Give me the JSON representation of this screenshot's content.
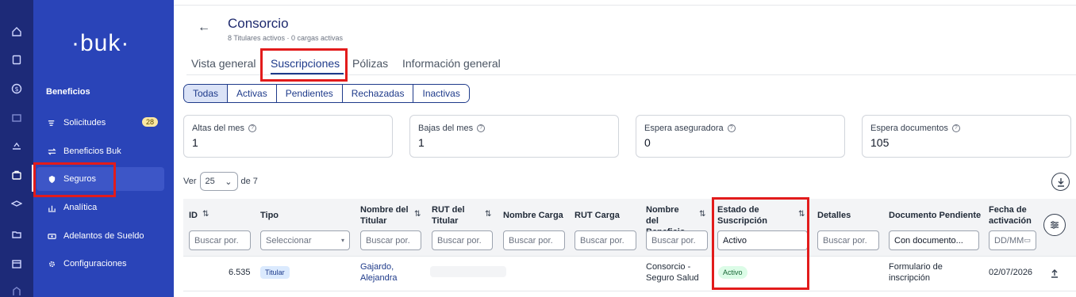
{
  "app": {
    "logo": "·buk·",
    "section_title": "Beneficios",
    "nav": [
      {
        "label": "Solicitudes",
        "badge": "28"
      },
      {
        "label": "Beneficios Buk"
      },
      {
        "label": "Seguros"
      },
      {
        "label": "Analítica"
      },
      {
        "label": "Adelantos de Sueldo"
      },
      {
        "label": "Configuraciones"
      }
    ],
    "rail_icons": [
      "home-icon",
      "clipboard-icon",
      "dollar-icon",
      "bank-icon",
      "hand-heart-icon",
      "briefcase-icon",
      "graduation-icon",
      "folder-icon",
      "store-icon",
      "building-icon"
    ]
  },
  "header": {
    "back": "←",
    "title": "Consorcio",
    "subtitle": "8 Titulares activos · 0 cargas activas"
  },
  "tabs": [
    "Vista general",
    "Suscripciones",
    "Pólizas",
    "Información general"
  ],
  "filters": [
    "Todas",
    "Activas",
    "Pendientes",
    "Rechazadas",
    "Inactivas"
  ],
  "cards": [
    {
      "label": "Altas del mes",
      "value": "1"
    },
    {
      "label": "Bajas del mes",
      "value": "1"
    },
    {
      "label": "Espera aseguradora",
      "value": "0"
    },
    {
      "label": "Espera documentos",
      "value": "105"
    }
  ],
  "pager": {
    "prefix": "Ver",
    "value": "25",
    "suffix": "de 7"
  },
  "table": {
    "headers": [
      "ID",
      "Tipo",
      "Nombre del Titular",
      "RUT del Titular",
      "Nombre Carga",
      "RUT Carga",
      "Nombre del Beneficio",
      "Estado de Suscripción",
      "Detalles",
      "Documento Pendiente",
      "Fecha de activación"
    ],
    "filters": {
      "id": "Buscar por.",
      "tipo": "Seleccionar",
      "titular": "Buscar por.",
      "rut_titular": "Buscar por.",
      "nombre_carga": "Buscar por.",
      "rut_carga": "Buscar por.",
      "beneficio": "Buscar por.",
      "estado": "Activo",
      "detalles": "Buscar por.",
      "documento": "Con documento...",
      "fecha": "DD/MM"
    },
    "row": {
      "id": "6.535",
      "tipo": "Titular",
      "titular_1": "Gajardo,",
      "titular_2": "Alejandra",
      "beneficio_1": "Consorcio -",
      "beneficio_2": "Seguro Salud",
      "estado": "Activo",
      "documento_1": "Formulario de",
      "documento_2": "inscripción",
      "fecha": "02/07/2026"
    }
  },
  "colors": {
    "rail": "#1d2a78",
    "sidebar": "#2a44b8",
    "accent": "#1e3a8a",
    "highlight": "#e21b1b"
  }
}
